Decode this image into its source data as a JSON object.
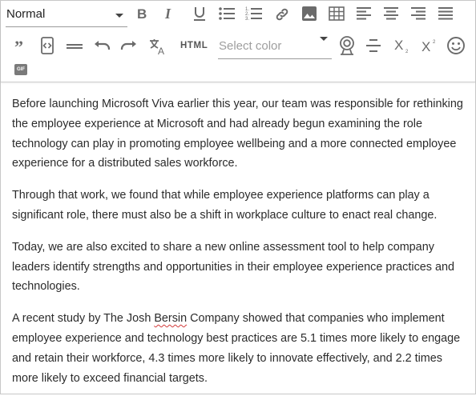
{
  "toolbar": {
    "format_value": "Normal",
    "color_placeholder": "Select color",
    "html_label": "HTML",
    "gif_label": "GIF",
    "icons": [
      "bold-icon",
      "italic-icon",
      "underline-icon",
      "bullet-list-icon",
      "numbered-list-icon",
      "link-icon",
      "image-icon",
      "table-icon",
      "align-left-icon",
      "align-center-icon",
      "align-right-icon",
      "justify-icon",
      "quote-icon",
      "code-view-icon",
      "horizontal-rule-icon",
      "undo-icon",
      "redo-icon",
      "translate-icon",
      "html-icon",
      "webcam-icon",
      "strikethrough-icon",
      "subscript-icon",
      "superscript-icon",
      "emoji-icon",
      "gif-icon"
    ]
  },
  "content": {
    "p1": "Before launching Microsoft Viva earlier this year, our team was responsible for rethinking the employee experience at Microsoft and had already begun examining the role technology can play in promoting employee wellbeing and a more connected employee experience for a distributed sales workforce.",
    "p2": "Through that work, we found that while employee experience platforms can play a significant role, there must also be a shift in workplace culture to enact real change.",
    "p3": "Today, we are also excited to share a new online assessment tool to help company leaders identify strengths and opportunities in their employee experience practices and technologies.",
    "p4_a": "A recent study by The Josh ",
    "p4_misspelled": "Bersin",
    "p4_b": " Company showed that companies who implement employee experience and technology best practices are 5.1 times more likely to engage and retain their workforce, 4.3 times more likely to innovate effectively, and 2.2 times more likely to exceed financial targets."
  }
}
